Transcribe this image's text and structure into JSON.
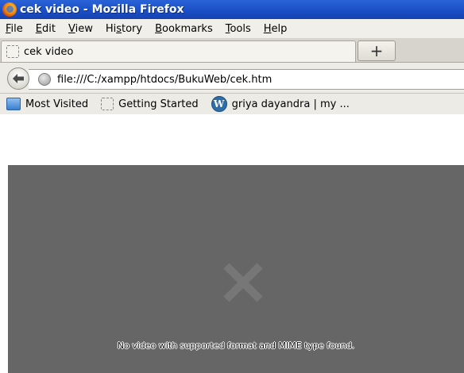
{
  "window": {
    "title": "cek video - Mozilla Firefox"
  },
  "menu": {
    "items": [
      {
        "prefix": "",
        "accel": "F",
        "rest": "ile"
      },
      {
        "prefix": "",
        "accel": "E",
        "rest": "dit"
      },
      {
        "prefix": "",
        "accel": "V",
        "rest": "iew"
      },
      {
        "prefix": "Hi",
        "accel": "s",
        "rest": "tory"
      },
      {
        "prefix": "",
        "accel": "B",
        "rest": "ookmarks"
      },
      {
        "prefix": "",
        "accel": "T",
        "rest": "ools"
      },
      {
        "prefix": "",
        "accel": "H",
        "rest": "elp"
      }
    ]
  },
  "tabs": {
    "active_label": "cek video",
    "new_tab_symbol": "+"
  },
  "nav": {
    "url": "file:///C:/xampp/htdocs/BukuWeb/cek.htm"
  },
  "bookmarks": {
    "items": [
      {
        "label": "Most Visited",
        "icon": "folder-icon"
      },
      {
        "label": "Getting Started",
        "icon": "page-icon"
      },
      {
        "label": "griya dayandra | my ...",
        "icon": "wordpress-icon"
      }
    ]
  },
  "video": {
    "error_message": "No video with supported format and MIME type found."
  },
  "colors": {
    "titlebar": "#1b4fc7",
    "video_bg": "#666666",
    "error_x": "#777777"
  }
}
